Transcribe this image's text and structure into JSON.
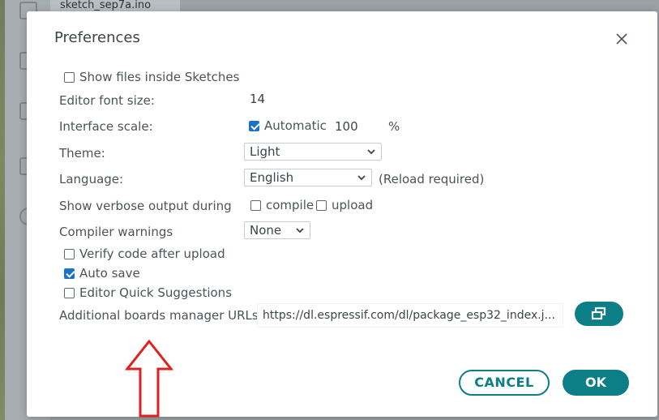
{
  "background": {
    "tab_title": "sketch_sep7a.ino"
  },
  "dialog": {
    "title": "Preferences"
  },
  "settings": {
    "show_files": {
      "label": "Show files inside Sketches",
      "checked": false
    },
    "font_size": {
      "label": "Editor font size:",
      "value": "14"
    },
    "interface_scale": {
      "label": "Interface scale:",
      "automatic_label": "Automatic",
      "automatic_checked": true,
      "value": "100",
      "unit": "%"
    },
    "theme": {
      "label": "Theme:",
      "selected": "Light"
    },
    "language": {
      "label": "Language:",
      "selected": "English",
      "note": "(Reload required)"
    },
    "verbose": {
      "label": "Show verbose output during",
      "compile_label": "compile",
      "compile_checked": false,
      "upload_label": "upload",
      "upload_checked": false
    },
    "compiler_warnings": {
      "label": "Compiler warnings",
      "selected": "None"
    },
    "verify_upload": {
      "label": "Verify code after upload",
      "checked": false
    },
    "auto_save": {
      "label": "Auto save",
      "checked": true
    },
    "quick_suggestions": {
      "label": "Editor Quick Suggestions",
      "checked": false
    },
    "boards_urls": {
      "label": "Additional boards manager URLs:",
      "value": "https://dl.espressif.com/dl/package_esp32_index.j..."
    }
  },
  "buttons": {
    "cancel": "CANCEL",
    "ok": "OK"
  },
  "colors": {
    "accent": "#0b7e86",
    "checkbox_checked": "#1a73c9",
    "annotation_arrow": "#e02020"
  }
}
